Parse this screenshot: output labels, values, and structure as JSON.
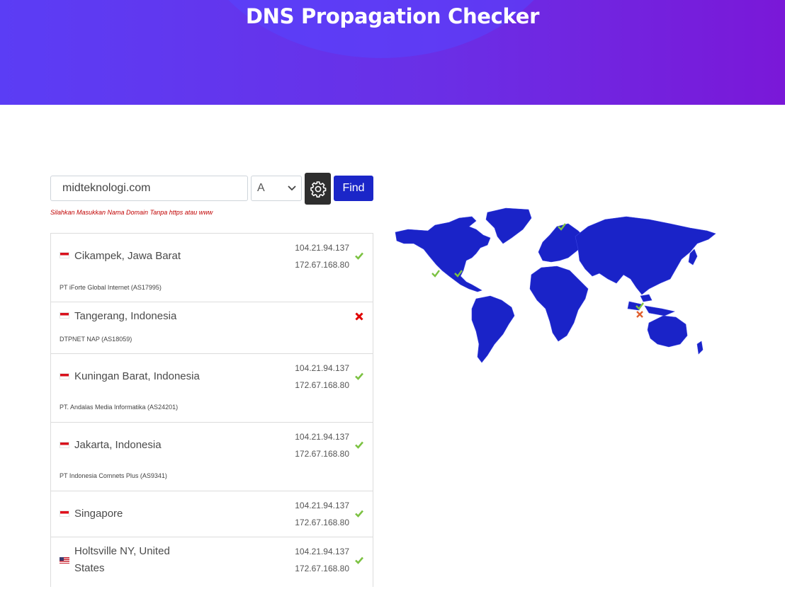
{
  "header": {
    "title": "DNS Propagation Checker"
  },
  "search": {
    "domain_value": "midteknologi.com",
    "record_type": "A",
    "find_label": "Find",
    "hint": "Silahkan Masukkan Nama Domain Tanpa https atau www"
  },
  "results": [
    {
      "location": "Cikampek, Jawa Barat",
      "isp": "PT iForte Global Internet (AS17995)",
      "ip1": "104.21.94.137",
      "ip2": "172.67.168.80",
      "status": "ok",
      "flag": "id"
    },
    {
      "location": "Tangerang, Indonesia",
      "isp": "DTPNET NAP (AS18059)",
      "ip1": "",
      "ip2": "",
      "status": "fail",
      "flag": "id"
    },
    {
      "location": "Kuningan Barat, Indonesia",
      "isp": "PT. Andalas Media Informatika (AS24201)",
      "ip1": "104.21.94.137",
      "ip2": "172.67.168.80",
      "status": "ok",
      "flag": "id"
    },
    {
      "location": "Jakarta, Indonesia",
      "isp": "PT Indonesia Comnets Plus (AS9341)",
      "ip1": "104.21.94.137",
      "ip2": "172.67.168.80",
      "status": "ok",
      "flag": "id"
    },
    {
      "location": "Singapore",
      "isp": "",
      "ip1": "104.21.94.137",
      "ip2": "172.67.168.80",
      "status": "ok",
      "flag": "sg"
    },
    {
      "location_line1": "Holtsville NY, United",
      "location_line2": "States",
      "isp": "",
      "ip1": "104.21.94.137",
      "ip2": "172.67.168.80",
      "status": "ok",
      "flag": "us"
    }
  ],
  "colors": {
    "accent": "#1b26c8",
    "map_land": "#1a23c8",
    "ok": "#7cc242",
    "fail": "#e00000",
    "hero_start": "#5b3df5",
    "hero_end": "#7a18d8"
  },
  "icons": {
    "settings": "gear-icon",
    "ok": "check-icon",
    "fail": "cross-icon",
    "select": "chevron-down-icon"
  }
}
